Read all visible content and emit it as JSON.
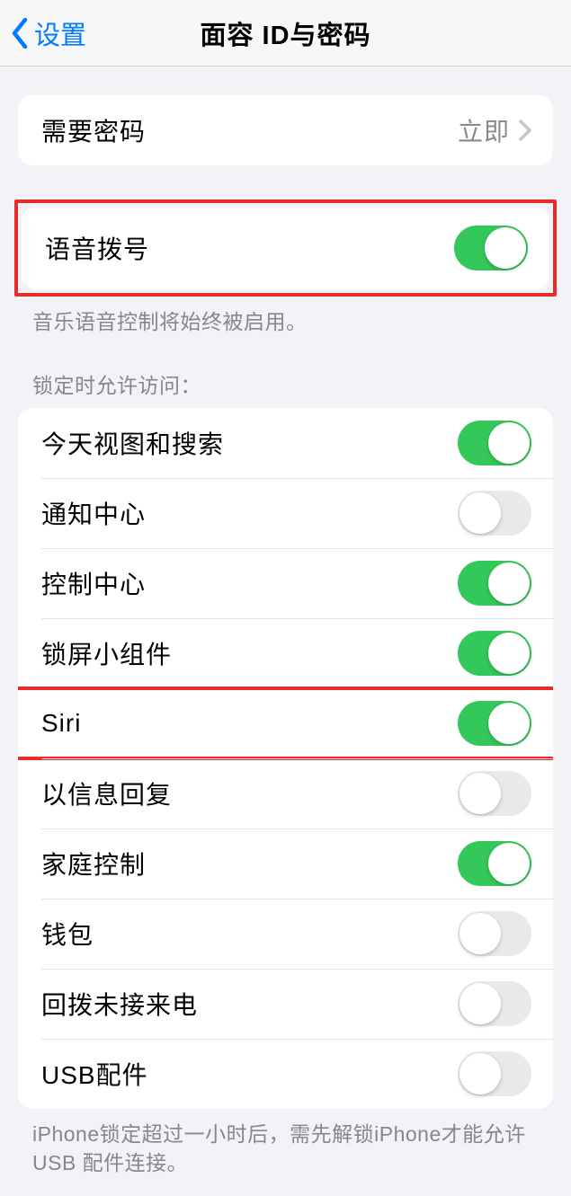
{
  "nav": {
    "back": "设置",
    "title": "面容 ID与密码"
  },
  "passcode": {
    "label": "需要密码",
    "value": "立即"
  },
  "voicedial": {
    "label": "语音拨号",
    "footer": "音乐语音控制将始终被启用。"
  },
  "lockaccess": {
    "header": "锁定时允许访问：",
    "items": [
      {
        "label": "今天视图和搜索",
        "on": true
      },
      {
        "label": "通知中心",
        "on": false
      },
      {
        "label": "控制中心",
        "on": true
      },
      {
        "label": "锁屏小组件",
        "on": true
      },
      {
        "label": "Siri",
        "on": true,
        "highlight": true
      },
      {
        "label": "以信息回复",
        "on": false
      },
      {
        "label": "家庭控制",
        "on": true
      },
      {
        "label": "钱包",
        "on": false
      },
      {
        "label": "回拨未接来电",
        "on": false
      },
      {
        "label": "USB配件",
        "on": false
      }
    ],
    "footer": "iPhone锁定超过一小时后，需先解锁iPhone才能允许USB 配件连接。"
  }
}
